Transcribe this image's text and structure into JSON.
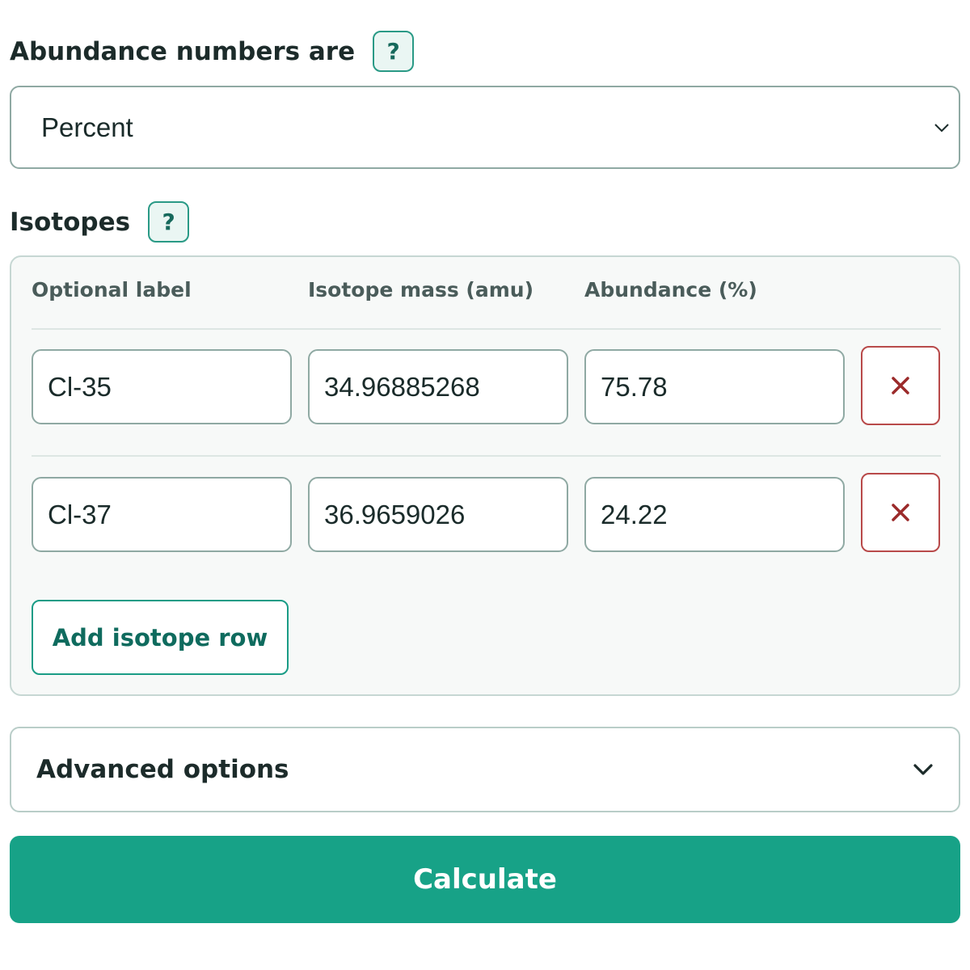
{
  "abundance": {
    "label": "Abundance numbers are",
    "help": "?",
    "selected": "Percent"
  },
  "isotopes": {
    "label": "Isotopes",
    "help": "?",
    "columns": [
      "Optional label",
      "Isotope mass (amu)",
      "Abundance (%)"
    ],
    "rows": [
      {
        "label": "Cl-35",
        "mass": "34.96885268",
        "abundance": "75.78"
      },
      {
        "label": "Cl-37",
        "mass": "36.9659026",
        "abundance": "24.22"
      }
    ],
    "add_label": "Add isotope row"
  },
  "advanced": {
    "label": "Advanced options"
  },
  "calculate": {
    "label": "Calculate"
  },
  "colors": {
    "accent": "#17a287",
    "delete": "#9b2a2a"
  },
  "icons": {
    "help": "question-mark-icon",
    "select": "chevron-down-icon",
    "delete": "close-icon",
    "advanced": "chevron-down-icon"
  }
}
